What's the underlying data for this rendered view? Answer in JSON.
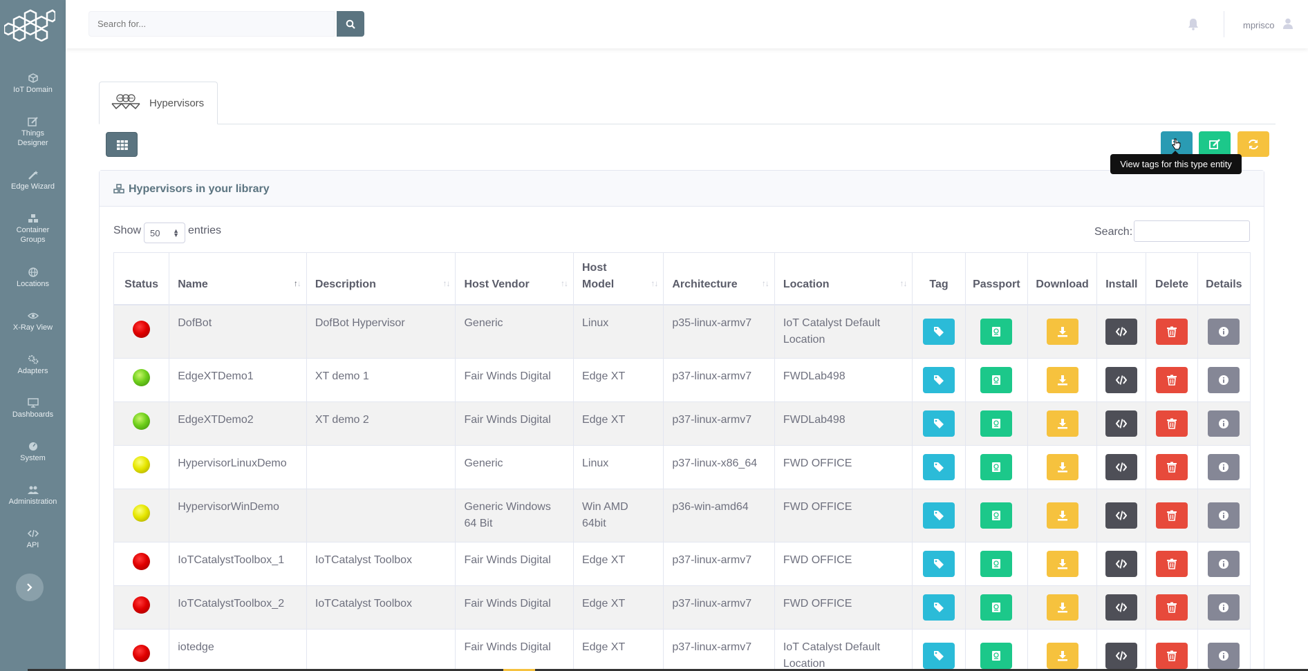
{
  "sidebar": {
    "items": [
      {
        "label": "IoT Domain",
        "icon": "cube-icon"
      },
      {
        "label": "Things Designer",
        "icon": "edit-icon"
      },
      {
        "label": "Edge Wizard",
        "icon": "magic-wand-icon"
      },
      {
        "label": "Container Groups",
        "icon": "cubes-icon"
      },
      {
        "label": "Locations",
        "icon": "globe-icon"
      },
      {
        "label": "X-Ray View",
        "icon": "eye-icon"
      },
      {
        "label": "Adapters",
        "icon": "cogs-icon"
      },
      {
        "label": "Dashboards",
        "icon": "desktop-icon"
      },
      {
        "label": "System",
        "icon": "dashboard-icon"
      },
      {
        "label": "Administration",
        "icon": "users-icon"
      },
      {
        "label": "API",
        "icon": "code-icon"
      }
    ]
  },
  "topbar": {
    "search_placeholder": "Search for...",
    "username": "mprisco"
  },
  "tab": {
    "label": "Hypervisors"
  },
  "toolbar": {
    "tooltip": "View tags for this type entity"
  },
  "card": {
    "title": "Hypervisors in your library",
    "show_label": "Show",
    "entries_value": "50",
    "entries_label": "entries",
    "search_label": "Search:"
  },
  "table": {
    "columns": [
      "Status",
      "Name",
      "Description",
      "Host Vendor",
      "Host Model",
      "Architecture",
      "Location",
      "Tag",
      "Passport",
      "Download",
      "Install",
      "Delete",
      "Details"
    ],
    "rows": [
      {
        "status": "red",
        "name": "DofBot",
        "description": "DofBot Hypervisor",
        "vendor": "Generic",
        "model": "Linux",
        "arch": "p35-linux-armv7",
        "location": "IoT Catalyst Default Location"
      },
      {
        "status": "green",
        "name": "EdgeXTDemo1",
        "description": "XT demo 1",
        "vendor": "Fair Winds Digital",
        "model": "Edge XT",
        "arch": "p37-linux-armv7",
        "location": "FWDLab498"
      },
      {
        "status": "green",
        "name": "EdgeXTDemo2",
        "description": "XT demo 2",
        "vendor": "Fair Winds Digital",
        "model": "Edge XT",
        "arch": "p37-linux-armv7",
        "location": "FWDLab498"
      },
      {
        "status": "yellow",
        "name": "HypervisorLinuxDemo",
        "description": "",
        "vendor": "Generic",
        "model": "Linux",
        "arch": "p37-linux-x86_64",
        "location": "FWD OFFICE"
      },
      {
        "status": "yellow",
        "name": "HypervisorWinDemo",
        "description": "",
        "vendor": "Generic Windows 64 Bit",
        "model": "Win AMD 64bit",
        "arch": "p36-win-amd64",
        "location": "FWD OFFICE"
      },
      {
        "status": "red",
        "name": "IoTCatalystToolbox_1",
        "description": "IoTCatalyst Toolbox",
        "vendor": "Fair Winds Digital",
        "model": "Edge XT",
        "arch": "p37-linux-armv7",
        "location": "FWD OFFICE"
      },
      {
        "status": "red",
        "name": "IoTCatalystToolbox_2",
        "description": "IoTCatalyst Toolbox",
        "vendor": "Fair Winds Digital",
        "model": "Edge XT",
        "arch": "p37-linux-armv7",
        "location": "FWD OFFICE"
      },
      {
        "status": "red",
        "name": "iotedge",
        "description": "",
        "vendor": "Fair Winds Digital",
        "model": "Edge XT",
        "arch": "p37-linux-armv7",
        "location": "IoT Catalyst Default Location"
      }
    ]
  },
  "colors": {
    "sidebar": "#6b8591",
    "primary": "#5b7480",
    "tag": "#2bbbd8",
    "passport": "#1cc88a",
    "download": "#f6c23e",
    "install": "#4e4f57",
    "delete": "#e74a3b",
    "details": "#858796"
  }
}
